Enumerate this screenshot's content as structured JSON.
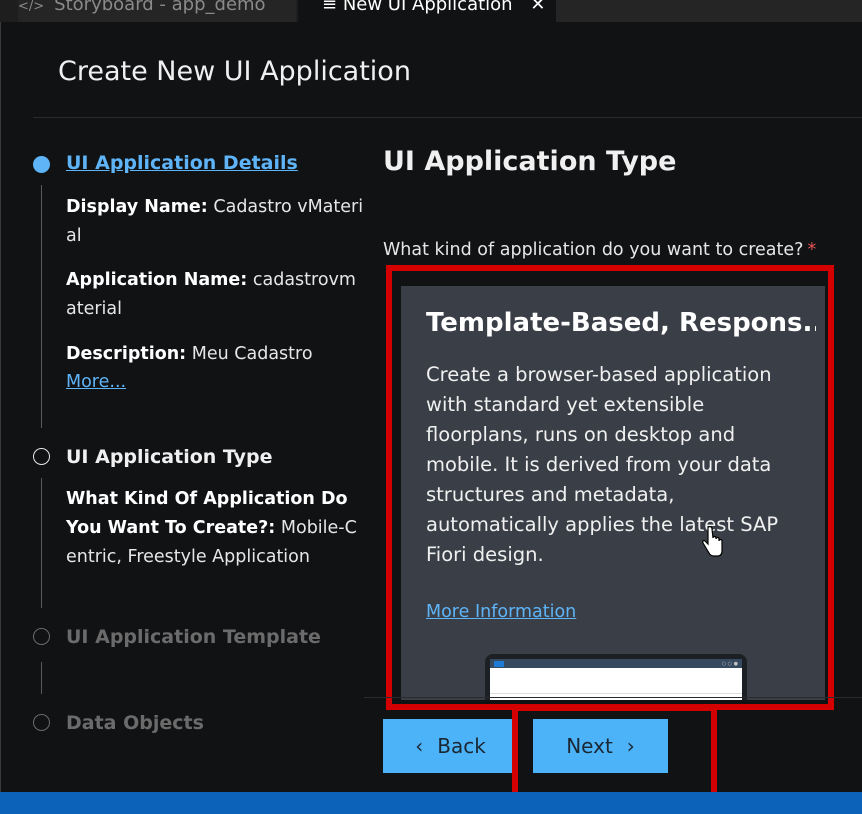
{
  "tabs": [
    {
      "icon": "code-brackets-icon",
      "label": "Storyboard - app_demo"
    },
    {
      "icon": "menu-icon",
      "label": "New UI Application"
    }
  ],
  "dialog": {
    "title": "Create New UI Application"
  },
  "steps": [
    {
      "title": "UI Application Details",
      "state": "active",
      "summary": [
        {
          "label": "Display Name:",
          "value": "Cadastro vMaterial"
        },
        {
          "label": "Application Name:",
          "value": "cadastrovmaterial"
        },
        {
          "label": "Description:",
          "value": "Meu Cadastro"
        }
      ],
      "more_link": "More..."
    },
    {
      "title": "UI Application Type",
      "state": "current",
      "summary": [
        {
          "label": "What Kind Of Application Do You Want To Create?:",
          "value": "Mobile-Centric, Freestyle Application"
        }
      ]
    },
    {
      "title": "UI Application Template",
      "state": "disabled"
    },
    {
      "title": "Data Objects",
      "state": "disabled"
    }
  ],
  "content": {
    "section_title": "UI Application Type",
    "question": "What kind of application do you want to create?",
    "required_mark": "*",
    "card": {
      "title": "Template-Based, Respons...",
      "description": "Create a browser-based application with standard yet extensible floorplans, runs on desktop and mobile. It is derived from your data structures and metadata, automatically applies the latest SAP Fiori design.",
      "link": "More Information"
    }
  },
  "buttons": {
    "back": "Back",
    "next": "Next"
  },
  "colors": {
    "accent": "#4db3f9",
    "highlight": "#d40000",
    "card_bg": "#3a3f47",
    "panel_bg": "#111214"
  }
}
